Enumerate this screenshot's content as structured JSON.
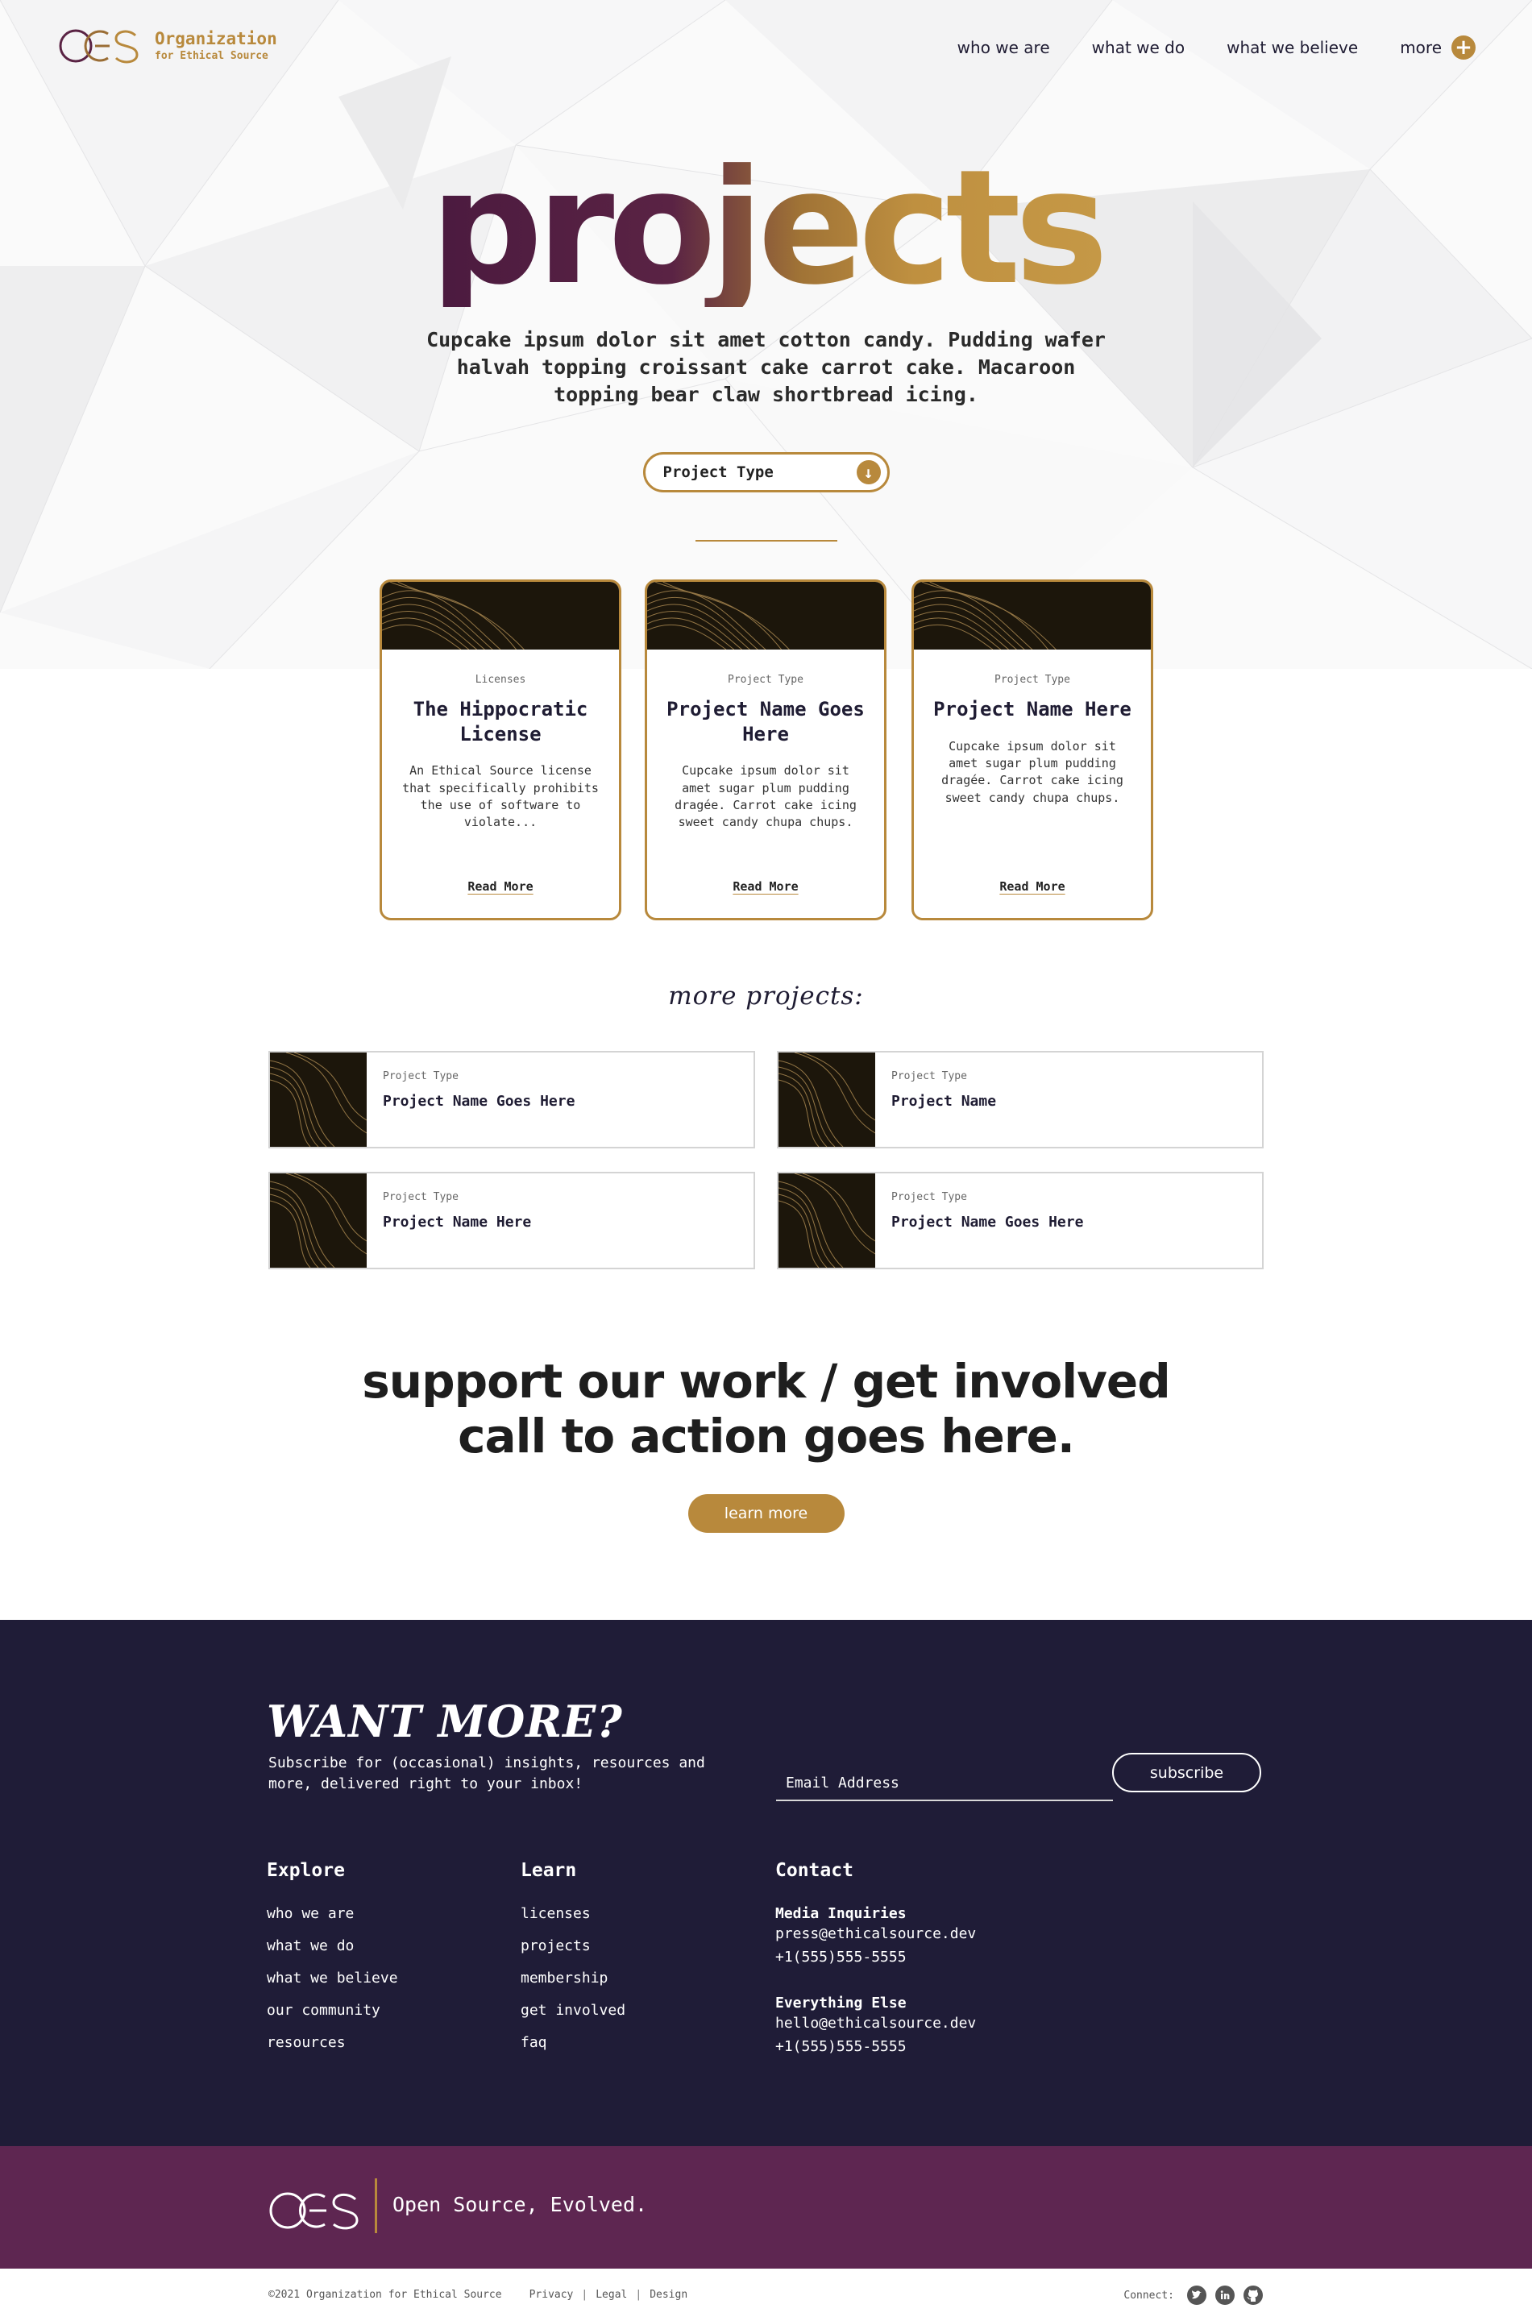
{
  "header": {
    "logo_line1": "Organization",
    "logo_line2": "for Ethical Source",
    "nav": {
      "who": "who we are",
      "what": "what we do",
      "believe": "what we believe",
      "more": "more",
      "more_icon": "plus-circle-icon"
    }
  },
  "hero": {
    "title": "projects",
    "description": "Cupcake ipsum dolor sit amet cotton candy. Pudding wafer halvah topping croissant cake carrot cake. Macaroon topping bear claw shortbread icing.",
    "filter_label": "Project Type",
    "filter_icon": "arrow-down-circle-icon"
  },
  "featured": [
    {
      "category": "Licenses",
      "title": "The Hippocratic License",
      "description": "An Ethical Source license that specifically prohibits the use of software to violate...",
      "link": "Read More"
    },
    {
      "category": "Project Type",
      "title": "Project Name Goes Here",
      "description": "Cupcake ipsum dolor sit amet sugar plum pudding dragée. Carrot cake icing sweet candy chupa chups.",
      "link": "Read More"
    },
    {
      "category": "Project Type",
      "title": "Project Name Here",
      "description": "Cupcake ipsum dolor sit amet sugar plum pudding dragée. Carrot cake icing sweet candy chupa chups.",
      "link": "Read More"
    }
  ],
  "more_projects": {
    "heading": "more projects:",
    "items": [
      {
        "category": "Project Type",
        "title": "Project Name Goes Here"
      },
      {
        "category": "Project Type",
        "title": "Project Name"
      },
      {
        "category": "Project Type",
        "title": "Project Name Here"
      },
      {
        "category": "Project Type",
        "title": "Project Name Goes Here"
      }
    ]
  },
  "cta": {
    "line1": "support our work / get involved",
    "line2": "call to action goes here.",
    "button": "learn more"
  },
  "footer": {
    "want_more": "WANT MORE?",
    "subscribe_text": "Subscribe for (occasional) insights, resources and more, delivered right to your inbox!",
    "email_placeholder": "Email Address",
    "subscribe_button": "subscribe",
    "explore": {
      "heading": "Explore",
      "links": [
        "who we are",
        "what we do",
        "what we believe",
        "our community",
        "resources"
      ]
    },
    "learn": {
      "heading": "Learn",
      "links": [
        "licenses",
        "projects",
        "membership",
        "get involved",
        "faq"
      ]
    },
    "contact": {
      "heading": "Contact",
      "media_label": "Media Inquiries",
      "media_email": "press@ethicalsource.dev",
      "media_phone": "+1(555)555-5555",
      "else_label": "Everything Else",
      "else_email": "hello@ethicalsource.dev",
      "else_phone": "+1(555)555-5555"
    },
    "tagline": "Open Source, Evolved.",
    "copyright": "©2021 Organization for Ethical Source",
    "legal_links": [
      "Privacy",
      "Legal",
      "Design"
    ],
    "connect_label": "Connect:",
    "social_icons": [
      "twitter-icon",
      "linkedin-icon",
      "github-icon"
    ]
  },
  "colors": {
    "accent_gold": "#b8893c",
    "plum": "#5e2651",
    "navy": "#1f1c37",
    "dark_thumb": "#1c160b"
  }
}
